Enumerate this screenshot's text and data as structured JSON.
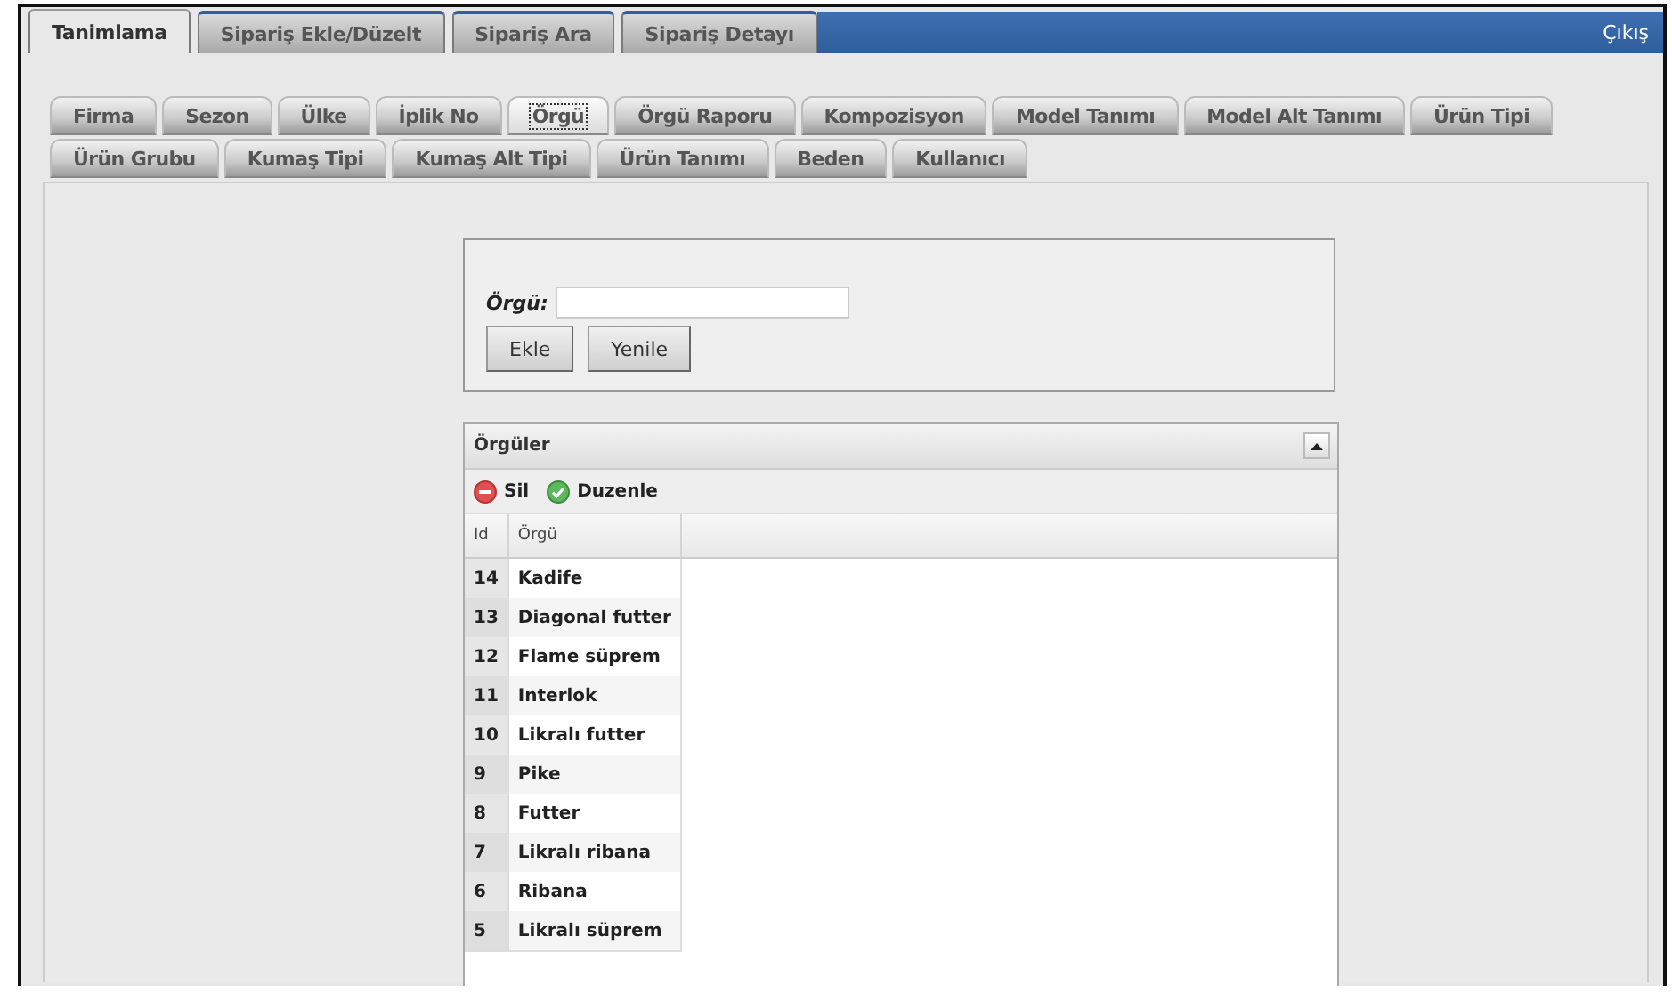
{
  "main_tabs": [
    {
      "label": "Tanimlama",
      "selected": true
    },
    {
      "label": "Sipariş Ekle/Düzelt",
      "selected": false
    },
    {
      "label": "Sipariş Ara",
      "selected": false
    },
    {
      "label": "Sipariş Detayı",
      "selected": false
    }
  ],
  "logout": "Çıkış",
  "sub_tab_rows": [
    [
      {
        "label": "Firma",
        "selected": false
      },
      {
        "label": "Sezon",
        "selected": false
      },
      {
        "label": "Ülke",
        "selected": false
      },
      {
        "label": "İplik No",
        "selected": false
      },
      {
        "label": "Örgü",
        "selected": true
      },
      {
        "label": "Örgü Raporu",
        "selected": false
      },
      {
        "label": "Kompozisyon",
        "selected": false
      },
      {
        "label": "Model Tanımı",
        "selected": false
      },
      {
        "label": "Model Alt Tanımı",
        "selected": false
      },
      {
        "label": "Ürün Tipi",
        "selected": false
      }
    ],
    [
      {
        "label": "Ürün Grubu",
        "selected": false
      },
      {
        "label": "Kumaş Tipi",
        "selected": false
      },
      {
        "label": "Kumaş Alt Tipi",
        "selected": false
      },
      {
        "label": "Ürün Tanımı",
        "selected": false
      },
      {
        "label": "Beden",
        "selected": false
      },
      {
        "label": "Kullanıcı",
        "selected": false
      }
    ]
  ],
  "form": {
    "label": "Örgü:",
    "buttons": [
      "Ekle",
      "Yenile"
    ]
  },
  "grid": {
    "title": "Örgüler",
    "tools": [
      {
        "kind": "delete",
        "label": "Sil"
      },
      {
        "kind": "edit",
        "label": "Duzenle"
      }
    ],
    "columns": [
      "Id",
      "Örgü"
    ],
    "rows": [
      [
        "14",
        "Kadife"
      ],
      [
        "13",
        "Diagonal futter"
      ],
      [
        "12",
        "Flame süprem"
      ],
      [
        "11",
        "Interlok"
      ],
      [
        "10",
        "Likralı futter"
      ],
      [
        "9",
        "Pike"
      ],
      [
        "8",
        "Futter"
      ],
      [
        "7",
        "Likralı ribana"
      ],
      [
        "6",
        "Ribana"
      ],
      [
        "5",
        "Likralı süprem"
      ]
    ]
  }
}
